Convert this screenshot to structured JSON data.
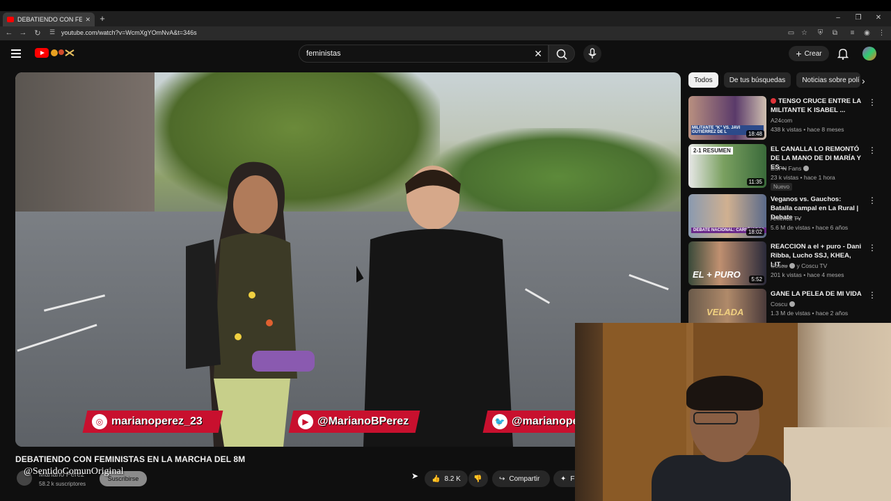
{
  "browser": {
    "tab_title": "DEBATIENDO CON FEMINI",
    "url": "youtube.com/watch?v=WcmXgYOmNvA&t=346s"
  },
  "header": {
    "search_query": "feministas",
    "create_label": "Crear"
  },
  "video": {
    "title": "DEBATIENDO CON FEMINISTAS EN LA MARCHA DEL 8M",
    "channel_name": "Mariano Perez",
    "subscribers": "58.2 k suscriptores",
    "subscribe_label": "Suscribirse",
    "like_count": "8.2 K",
    "share_label": "Compartir",
    "extra_label": "F",
    "overlay_handles": [
      "marianoperez_23",
      "@MarianoBPerez",
      "@marianope"
    ]
  },
  "watermark": "@SentidoComunOriginal",
  "chips": [
    "Todos",
    "De tus búsquedas",
    "Noticias sobre polí"
  ],
  "recommendations": [
    {
      "title": "TENSO CRUCE ENTRE LA MILITANTE K ISABEL ...",
      "channel": "A24com",
      "meta": "438 k vistas • hace 8 meses",
      "duration": "18:48",
      "thumb_text": "MILITANTE \"K\" VS. JAVI GUTIÉRREZ DE L",
      "live_dot": true
    },
    {
      "title": "EL CANALLA LO REMONTÓ DE LA MANO DE DI MARÍA Y ES ...",
      "channel": "ESPN Fans",
      "meta": "23 k vistas • hace 1 hora",
      "duration": "11:35",
      "badge": "Nuevo",
      "thumb_text": "2-1 RESUMEN"
    },
    {
      "title": "Veganos vs. Gauchos: Batalla campal en La Rural | Debate ...",
      "channel": "América TV",
      "meta": "5.6 M de vistas • hace 6 años",
      "duration": "18:02",
      "thumb_text": "DEBATE NACIONAL: CARNÍVOROS"
    },
    {
      "title": "REACCION a el + puro - Dani Ribba, Lucho SSJ, KHEA, LIT ...",
      "channel": "Coscu",
      "channel_extra": "y Coscu TV",
      "meta": "201 k vistas • hace 4 meses",
      "duration": "5:52",
      "thumb_text": "EL + PURO"
    },
    {
      "title": "GANE LA PELEA DE MI VIDA",
      "channel": "Coscu",
      "meta": "1.3 M de vistas • hace 2 años",
      "thumb_text": "VELADA"
    }
  ]
}
